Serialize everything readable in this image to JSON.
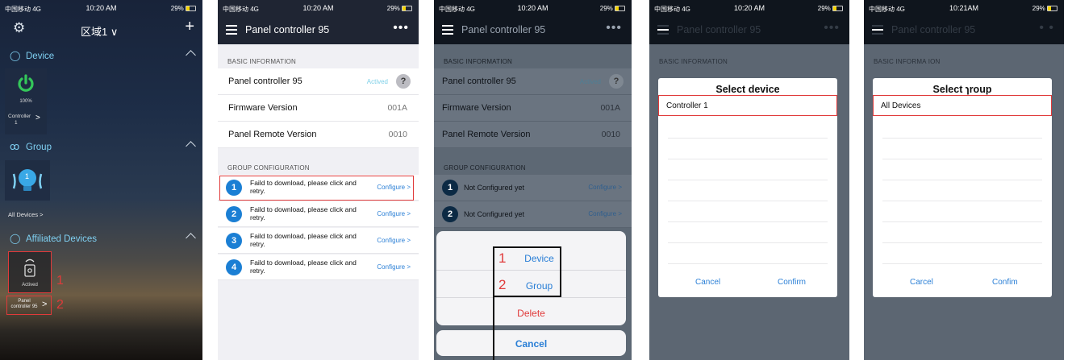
{
  "status": {
    "carrier": "中国移动 4G",
    "time": "10:20 AM",
    "time_alt": "10:21AM",
    "battery": "29%"
  },
  "colors": {
    "accent_blue": "#1b7fd4",
    "link_blue": "#2a7fd6",
    "power_green": "#34c75a",
    "highlight_red": "#e03a3a",
    "section_cyan": "#7fd0f2"
  },
  "screen1": {
    "region": "区域1 ∨",
    "add": "+",
    "sections": {
      "device": "Device",
      "group": "Group",
      "affiliated": "Affiliated Devices"
    },
    "device_tile": {
      "percent": "100%",
      "name_line1": "Controller",
      "name_line2": "1",
      "arrow": ">"
    },
    "group_tile": {
      "bulb_number": "1",
      "label": "All Devices  >"
    },
    "affiliated_tile": {
      "status": "Actived",
      "name_line1": "Panel",
      "name_line2": "controller 95",
      "arrow": ">"
    },
    "markers": [
      "1",
      "2"
    ]
  },
  "screen2": {
    "title": "Panel controller 95",
    "more": "•••",
    "basic_header": "BASIC INFORMATION",
    "rows": [
      {
        "label": "Panel controller 95",
        "value": "Actived"
      },
      {
        "label": "Firmware Version",
        "value": "001A"
      },
      {
        "label": "Panel Remote Version",
        "value": "0010"
      }
    ],
    "help": "?",
    "group_header": "GROUP CONFIGURATION",
    "groups": [
      {
        "num": "1",
        "msg": "Faild to download, please click and retry.",
        "action": "Configure  >"
      },
      {
        "num": "2",
        "msg": "Faild to download, please click and retry.",
        "action": "Configure  >"
      },
      {
        "num": "3",
        "msg": "Faild to download, please click and retry.",
        "action": "Configure  >"
      },
      {
        "num": "4",
        "msg": "Faild to download, please click and retry.",
        "action": "Configure  >"
      }
    ]
  },
  "screen3": {
    "title": "Panel controller 95",
    "more": "•••",
    "basic_header": "BASIC INFORMATION",
    "rows": [
      {
        "label": "Panel controller 95",
        "value": "Actived"
      },
      {
        "label": "Firmware Version",
        "value": "001A"
      },
      {
        "label": "Panel Remote Version",
        "value": "0010"
      }
    ],
    "help": "?",
    "group_header": "GROUP CONFIGURATION",
    "groups": [
      {
        "num": "1",
        "msg": "Not Configured yet",
        "action": "Configure  >"
      },
      {
        "num": "2",
        "msg": "Not Configured yet",
        "action": "Configure  >"
      }
    ],
    "sheet": {
      "device": "Device",
      "group": "Group",
      "delete": "Delete",
      "cancel": "Cancel"
    },
    "sheet_markers": [
      "1",
      "2"
    ]
  },
  "screen4": {
    "title": "Panel controller 95",
    "more": "•••",
    "basic_header": "BASIC INFORMATION",
    "dialog": {
      "title": "Select device",
      "option": "Controller 1",
      "cancel": "Cancel",
      "confirm": "Confirm"
    }
  },
  "screen5": {
    "title": "Panel controller 95",
    "more": "• •",
    "basic_header": "BASIC INFORMA ION",
    "dialog": {
      "title": "Select ɿroup",
      "option": "All Devices",
      "cancel": "Carcel",
      "confirm": "Confim"
    }
  }
}
